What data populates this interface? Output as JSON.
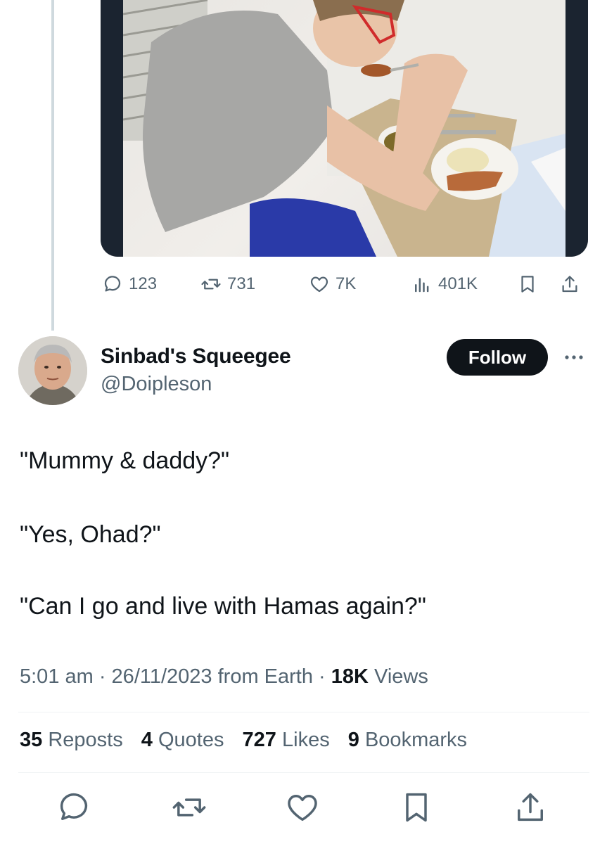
{
  "parent_tweet": {
    "actions": {
      "replies": "123",
      "reposts": "731",
      "likes": "7K",
      "views": "401K"
    }
  },
  "tweet": {
    "author": {
      "display_name": "Sinbad's Squeegee",
      "handle": "@Doipleson"
    },
    "follow_label": "Follow",
    "lines": [
      "\"Mummy & daddy?\"",
      "\"Yes, Ohad?\"",
      "\"Can I go and live with Hamas again?\""
    ],
    "meta": {
      "time_date": "5:01 am · 26/11/2023 from Earth · ",
      "views_count": "18K",
      "views_label": " Views"
    },
    "stats": {
      "reposts_count": "35",
      "reposts_label": " Reposts",
      "quotes_count": "4",
      "quotes_label": " Quotes",
      "likes_count": "727",
      "likes_label": " Likes",
      "bookmarks_count": "9",
      "bookmarks_label": " Bookmarks"
    }
  },
  "colors": {
    "text": "#0f1419",
    "secondary": "#536471",
    "divider": "#eff3f4",
    "thread_line": "#cfd9de"
  },
  "icons": [
    "reply-icon",
    "repost-icon",
    "like-icon",
    "views-icon",
    "bookmark-icon",
    "share-icon",
    "more-icon"
  ]
}
